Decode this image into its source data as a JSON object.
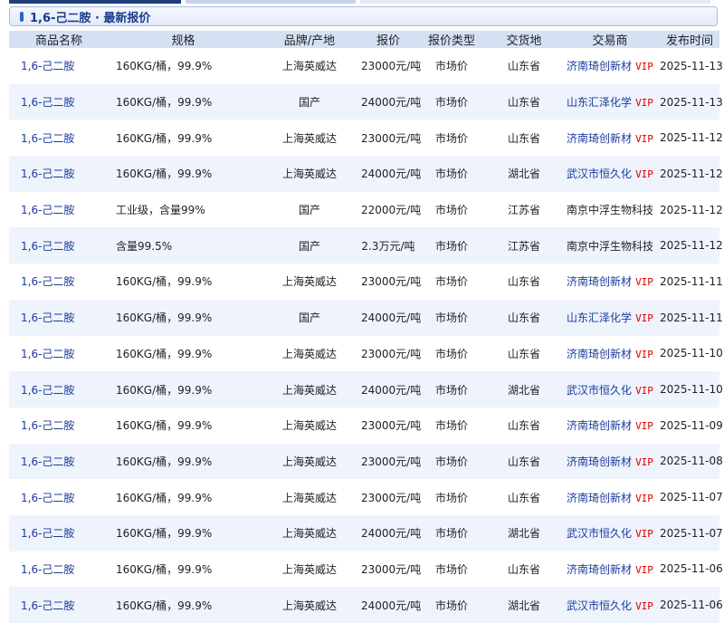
{
  "title": "1,6-己二胺 · 最新报价",
  "headers": [
    "商品名称",
    "规格",
    "品牌/产地",
    "报价",
    "报价类型",
    "交货地",
    "交易商",
    "发布时间"
  ],
  "vip_label": "VIP",
  "rows": [
    [
      "1,6-己二胺",
      "160KG/桶，99.9%",
      "上海英威达",
      "23000元/吨",
      "市场价",
      "山东省",
      "济南琦创新材",
      true,
      "2025-11-13"
    ],
    [
      "1,6-己二胺",
      "160KG/桶，99.9%",
      "国产",
      "24000元/吨",
      "市场价",
      "山东省",
      "山东汇泽化学",
      true,
      "2025-11-13"
    ],
    [
      "1,6-己二胺",
      "160KG/桶，99.9%",
      "上海英威达",
      "23000元/吨",
      "市场价",
      "山东省",
      "济南琦创新材",
      true,
      "2025-11-12"
    ],
    [
      "1,6-己二胺",
      "160KG/桶，99.9%",
      "上海英威达",
      "24000元/吨",
      "市场价",
      "湖北省",
      "武汉市恒久化",
      true,
      "2025-11-12"
    ],
    [
      "1,6-己二胺",
      "工业级，含量99%",
      "国产",
      "22000元/吨",
      "市场价",
      "江苏省",
      "南京中浮生物科技",
      false,
      "2025-11-12"
    ],
    [
      "1,6-己二胺",
      "含量99.5%",
      "国产",
      "2.3万元/吨",
      "市场价",
      "江苏省",
      "南京中浮生物科技",
      false,
      "2025-11-12"
    ],
    [
      "1,6-己二胺",
      "160KG/桶，99.9%",
      "上海英威达",
      "23000元/吨",
      "市场价",
      "山东省",
      "济南琦创新材",
      true,
      "2025-11-11"
    ],
    [
      "1,6-己二胺",
      "160KG/桶，99.9%",
      "国产",
      "24000元/吨",
      "市场价",
      "山东省",
      "山东汇泽化学",
      true,
      "2025-11-11"
    ],
    [
      "1,6-己二胺",
      "160KG/桶，99.9%",
      "上海英威达",
      "23000元/吨",
      "市场价",
      "山东省",
      "济南琦创新材",
      true,
      "2025-11-10"
    ],
    [
      "1,6-己二胺",
      "160KG/桶，99.9%",
      "上海英威达",
      "24000元/吨",
      "市场价",
      "湖北省",
      "武汉市恒久化",
      true,
      "2025-11-10"
    ],
    [
      "1,6-己二胺",
      "160KG/桶，99.9%",
      "上海英威达",
      "23000元/吨",
      "市场价",
      "山东省",
      "济南琦创新材",
      true,
      "2025-11-09"
    ],
    [
      "1,6-己二胺",
      "160KG/桶，99.9%",
      "上海英威达",
      "23000元/吨",
      "市场价",
      "山东省",
      "济南琦创新材",
      true,
      "2025-11-08"
    ],
    [
      "1,6-己二胺",
      "160KG/桶，99.9%",
      "上海英威达",
      "23000元/吨",
      "市场价",
      "山东省",
      "济南琦创新材",
      true,
      "2025-11-07"
    ],
    [
      "1,6-己二胺",
      "160KG/桶，99.9%",
      "上海英威达",
      "24000元/吨",
      "市场价",
      "湖北省",
      "武汉市恒久化",
      true,
      "2025-11-07"
    ],
    [
      "1,6-己二胺",
      "160KG/桶，99.9%",
      "上海英威达",
      "23000元/吨",
      "市场价",
      "山东省",
      "济南琦创新材",
      true,
      "2025-11-06"
    ],
    [
      "1,6-己二胺",
      "160KG/桶，99.9%",
      "上海英威达",
      "24000元/吨",
      "市场价",
      "湖北省",
      "武汉市恒久化",
      true,
      "2025-11-06"
    ]
  ]
}
